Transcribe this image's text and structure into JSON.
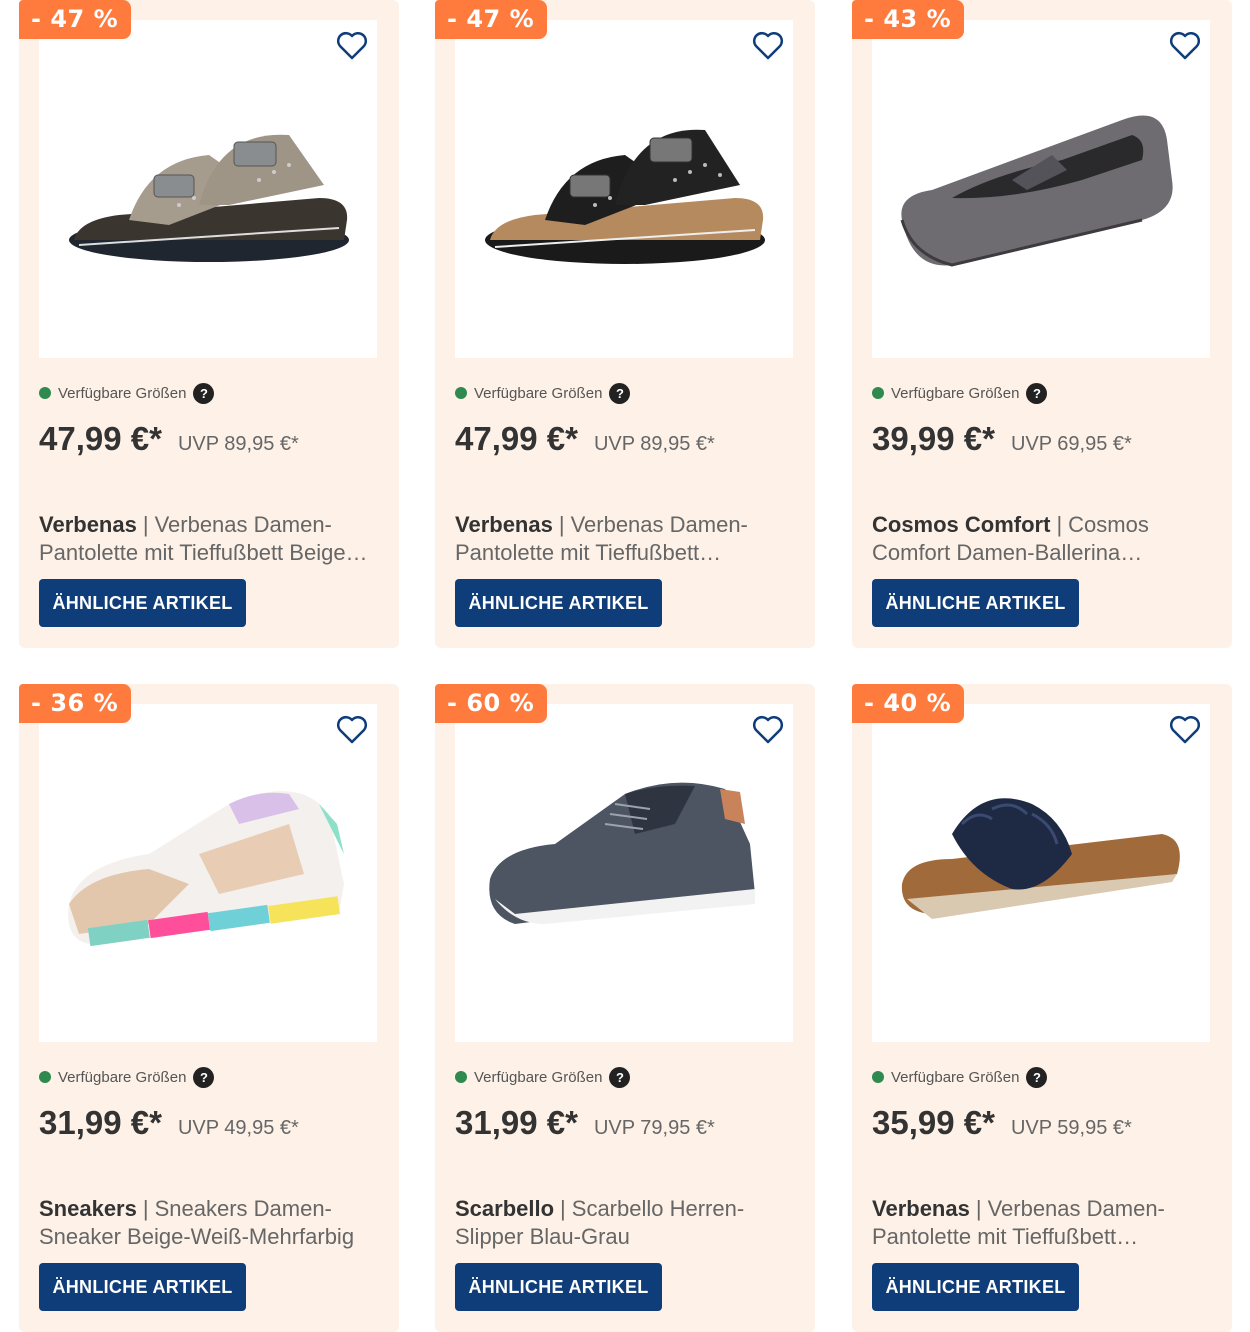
{
  "availability_label": "Verfügbare Größen",
  "help_glyph": "?",
  "button_label": "ÄHNLICHE ARTIKEL",
  "colors": {
    "card_bg": "#fdf1e8",
    "badge": "#ff7a3d",
    "button": "#0f3d7a",
    "available_dot": "#2f8a4f"
  },
  "products": [
    {
      "discount": "- 47 %",
      "price": "47,99 €*",
      "uvp": "UVP 89,95 €*",
      "brand": "Verbenas",
      "name": "Verbenas Damen-Pantolette mit Tieffußbett Beige…",
      "image": "sandal-beige-studded"
    },
    {
      "discount": "- 47 %",
      "price": "47,99 €*",
      "uvp": "UVP 89,95 €*",
      "brand": "Verbenas",
      "name": "Verbenas Damen-Pantolette mit Tieffußbett…",
      "image": "sandal-black-studded"
    },
    {
      "discount": "- 43 %",
      "price": "39,99 €*",
      "uvp": "UVP 69,95 €*",
      "brand": "Cosmos Comfort",
      "name": "Cosmos Comfort Damen-Ballerina…",
      "image": "ballerina-grey"
    },
    {
      "discount": "- 36 %",
      "price": "31,99 €*",
      "uvp": "UVP 49,95 €*",
      "brand": "Sneakers",
      "name": "Sneakers Damen-Sneaker Beige-Weiß-Mehrfarbig",
      "image": "sneaker-beige-multicolor"
    },
    {
      "discount": "- 60 %",
      "price": "31,99 €*",
      "uvp": "UVP 79,95 €*",
      "brand": "Scarbello",
      "name": "Scarbello Herren-Slipper Blau-Grau",
      "image": "slipper-blue-grey"
    },
    {
      "discount": "- 40 %",
      "price": "35,99 €*",
      "uvp": "UVP 59,95 €*",
      "brand": "Verbenas",
      "name": "Verbenas Damen-Pantolette mit Tieffußbett…",
      "image": "slide-navy-ruffle"
    }
  ]
}
